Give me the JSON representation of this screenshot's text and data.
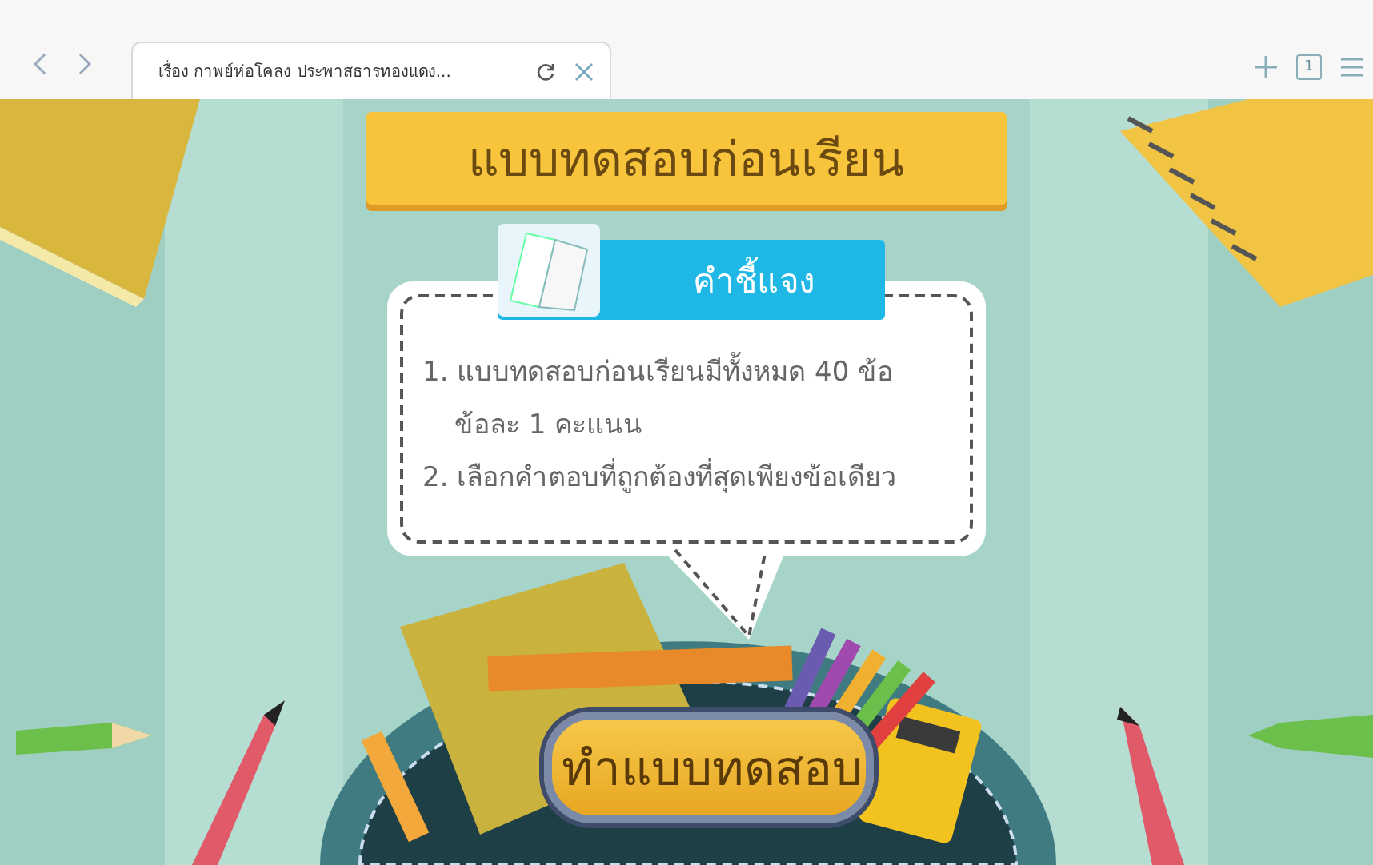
{
  "browser": {
    "tab_title": "เรื่อง กาพย์ห่อโคลง ประพาสธารทองแดง...",
    "tab_count": "1"
  },
  "slide": {
    "title": "แบบทดสอบก่อนเรียน",
    "instructions_heading": "คำชี้แจง",
    "instructions": [
      {
        "number": "1.",
        "text": "แบบทดสอบก่อนเรียนมีทั้งหมด 40 ข้อ",
        "continuation": "ข้อละ 1 คะแนน"
      },
      {
        "number": "2.",
        "text": "เลือกคำตอบที่ถูกต้องที่สุดเพียงข้อเดียว"
      }
    ],
    "start_button": "ทำแบบทดสอบ"
  }
}
